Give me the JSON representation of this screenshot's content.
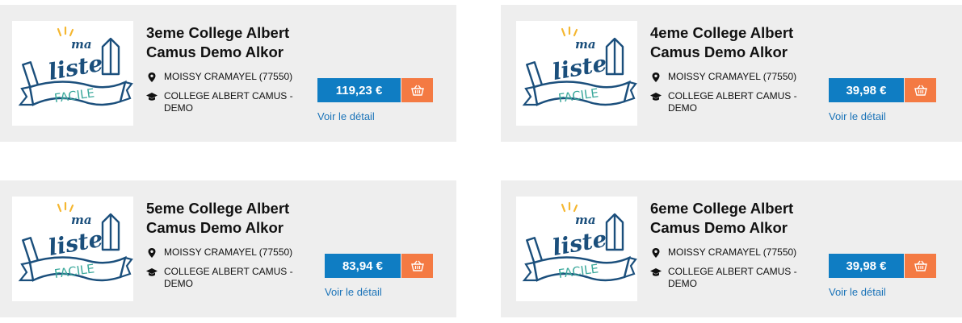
{
  "products": [
    {
      "title_line1": "3eme College Albert",
      "title_line2": "Camus Demo Alkor",
      "location": "MOISSY CRAMAYEL (77550)",
      "school": "COLLEGE ALBERT CAMUS - DEMO",
      "price": "119,23 €",
      "detail_label": "Voir le détail"
    },
    {
      "title_line1": "4eme College Albert",
      "title_line2": "Camus Demo Alkor",
      "location": "MOISSY CRAMAYEL (77550)",
      "school": "COLLEGE ALBERT CAMUS - DEMO",
      "price": "39,98 €",
      "detail_label": "Voir le détail"
    },
    {
      "title_line1": "5eme College Albert",
      "title_line2": "Camus Demo Alkor",
      "location": "MOISSY CRAMAYEL (77550)",
      "school": "COLLEGE ALBERT CAMUS - DEMO",
      "price": "83,94 €",
      "detail_label": "Voir le détail"
    },
    {
      "title_line1": "6eme College Albert",
      "title_line2": "Camus Demo Alkor",
      "location": "MOISSY CRAMAYEL (77550)",
      "school": "COLLEGE ALBERT CAMUS - DEMO",
      "price": "39,98 €",
      "detail_label": "Voir le détail"
    }
  ],
  "logo": {
    "word1": "ma",
    "word2": "liste",
    "word3": "FACILE"
  },
  "icons": {
    "location": "map-pin-icon",
    "school": "graduation-cap-icon",
    "cart": "basket-icon"
  },
  "colors": {
    "price_button": "#0f7dc3",
    "cart_button": "#f47a43",
    "link": "#1a73b8",
    "logo_navy": "#1b4f7c",
    "logo_teal": "#3aa89b",
    "logo_yellow": "#f5b731"
  }
}
